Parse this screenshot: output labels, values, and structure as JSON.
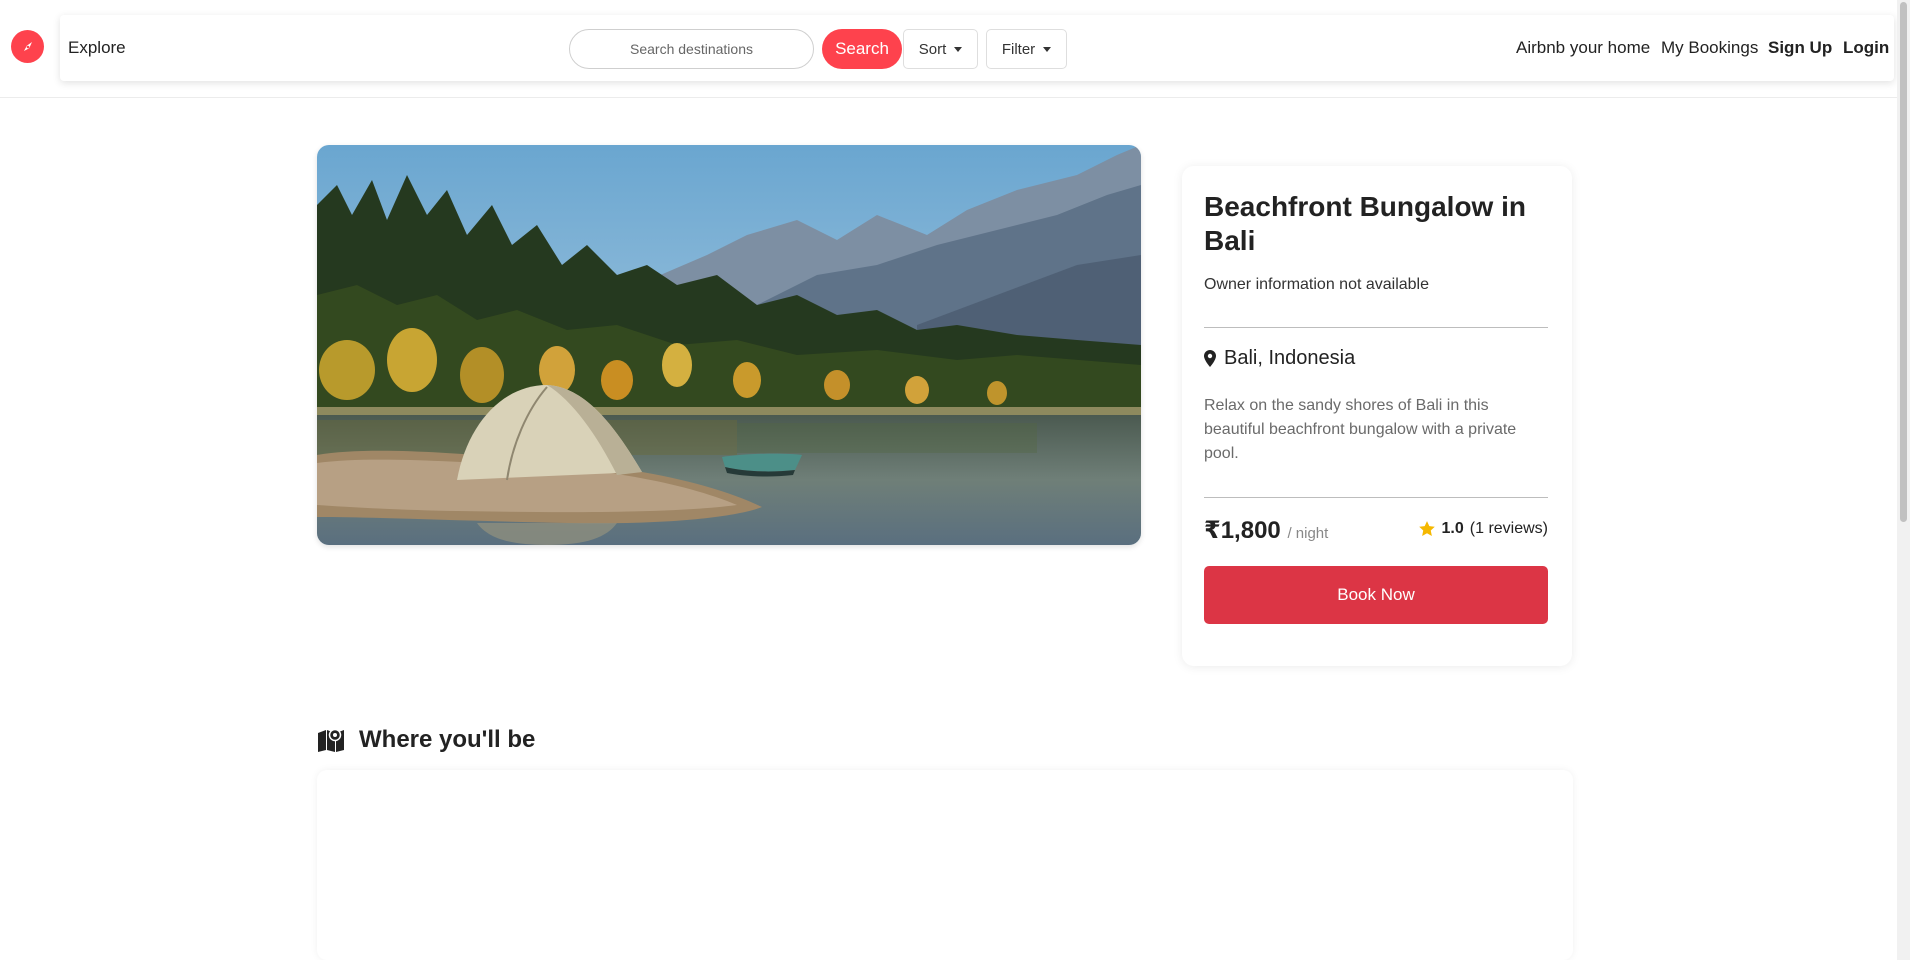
{
  "navbar": {
    "explore": "Explore",
    "search_placeholder": "Search destinations",
    "search_button": "Search",
    "sort_button": "Sort",
    "filter_button": "Filter",
    "host_link": "Airbnb your home",
    "bookings_link": "My Bookings",
    "signup_link": "Sign Up",
    "login_link": "Login",
    "logo_icon": "compass-icon"
  },
  "listing": {
    "image_icon": "listing-photo",
    "title": "Beachfront Bungalow in Bali",
    "owner": "Owner information not available",
    "location": "Bali, Indonesia",
    "description": "Relax on the sandy shores of Bali in this beautiful beachfront bungalow with a private pool.",
    "price": "₹1,800",
    "per_night": "/ night",
    "rating": "1.0",
    "reviews": "(1 reviews)",
    "book_button": "Book Now"
  },
  "map_section": {
    "heading": "Where you'll be"
  },
  "colors": {
    "brand": "#fe424d",
    "book_button": "#dc3545",
    "star": "#f5b800"
  }
}
